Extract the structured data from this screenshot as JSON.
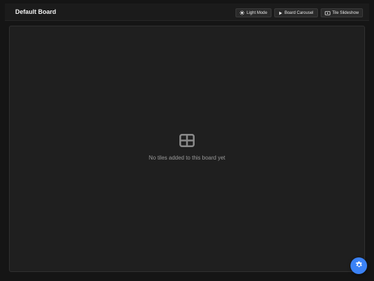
{
  "header": {
    "title": "Default Board"
  },
  "toolbar": {
    "buttons": [
      {
        "label": "Light Mode",
        "icon": "sun-icon"
      },
      {
        "label": "Board Carousel",
        "icon": "play-icon"
      },
      {
        "label": "Tile Slideshow",
        "icon": "slideshow-icon"
      }
    ]
  },
  "board": {
    "empty_icon": "grid-icon",
    "empty_message": "No tiles added to this board yet"
  },
  "fab": {
    "icon": "gear-icon"
  },
  "colors": {
    "background": "#151515",
    "surface": "#1f1f1f",
    "accent": "#3b82f6",
    "text": "#f2f2f2",
    "muted_text": "#9a9a9a"
  }
}
